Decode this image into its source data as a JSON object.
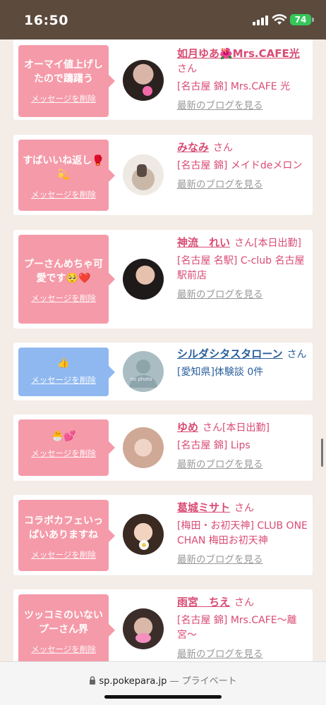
{
  "status": {
    "time": "16:50",
    "battery": "74"
  },
  "delete_label": "メッセージを削除",
  "blog_label": "最新のブログを見る",
  "san": "さん",
  "cards": [
    {
      "msg": "オーマイ値上げしたので躊躇う",
      "name": "如月ゆあ🌺Mrs.CAFE光",
      "suffix": "",
      "shop": "[名古屋 錦] Mrs.CAFE 光",
      "blog": true,
      "color": "pink"
    },
    {
      "msg": "すばいいね返し🥊💫",
      "name": "みなみ",
      "suffix": "",
      "shop": "[名古屋 錦] メイドdeメロン",
      "blog": true,
      "color": "pink"
    },
    {
      "msg": "プーさんめちゃ可愛です🥺❤️",
      "name": "神流　れい",
      "suffix": "[本日出勤]",
      "shop": "[名古屋 名駅] C-club 名古屋駅前店",
      "blog": true,
      "color": "pink"
    },
    {
      "msg": "👍",
      "name": "シルダシタスタローン",
      "suffix": "",
      "shop": "[愛知県]体験談 0件",
      "blog": false,
      "color": "blue"
    },
    {
      "msg": "🐣💕",
      "name": "ゆめ",
      "suffix": "[本日出勤]",
      "shop": "[名古屋 錦] Lips",
      "blog": true,
      "color": "pink"
    },
    {
      "msg": "コラボカフェいっぱいありますね",
      "name": "葛城ミサト",
      "suffix": "",
      "shop": "[梅田・お初天神] CLUB ONE CHAN 梅田お初天神",
      "blog": true,
      "color": "pink"
    },
    {
      "msg": "ツッコミのいないプーさん界",
      "name": "雨宮　ちえ",
      "suffix": "",
      "shop": "[名古屋 錦] Mrs.CAFE〜離宮〜",
      "blog": true,
      "color": "pink"
    }
  ],
  "avatar_no_photo": "no photo",
  "urlbar": {
    "domain": "sp.pokepara.jp",
    "sep": "—",
    "mode": "プライベート"
  }
}
